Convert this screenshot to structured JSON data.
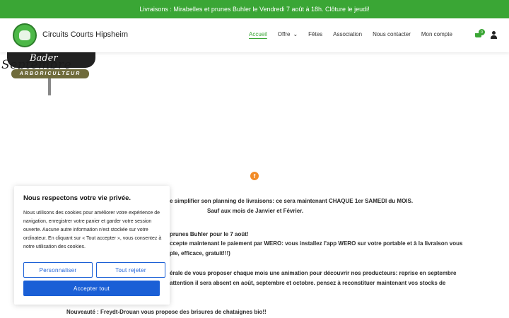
{
  "topbar": {
    "text": "Livraisons : Mirabelles et prunes Buhler le Vendredi 7 août à 18h. Clôture le jeudi!"
  },
  "header": {
    "site_title": "Circuits Courts Hipsheim",
    "nav": [
      {
        "label": "Accueil"
      },
      {
        "label": "Offre"
      },
      {
        "label": "Fêtes"
      },
      {
        "label": "Association"
      },
      {
        "label": "Nous contacter"
      },
      {
        "label": "Mon compte"
      }
    ],
    "cart_count": "0"
  },
  "sign": {
    "name": "Bader",
    "month": "Septembre",
    "subtitle": "ARBORICULTEUR"
  },
  "content": {
    "line1": "e simplifier son planning de livraisons: ce sera maintenant CHAQUE 1er SAMEDI du MOIS.",
    "line2": "Sauf aux mois de Janvier et Février.",
    "line3": " prunes Buhler pour le 7 août!",
    "line4": "ccepte maintenant le paiement par WERO: vous installez l'app WERO sur votre portable et à la livraison vous",
    "line5": "ple, efficace, gratuit!!!)",
    "line6": "érale de vous proposer chaque mois une animation pour découvrir nos producteurs: reprise en septembre",
    "line7": "attention il sera absent en août, septembre et octobre. pensez à reconstituer maintenant vos stocks de",
    "line8": "Nouveauté : Freydt-Drouan vous propose des brisures de chataignes bio!!"
  },
  "cookie": {
    "title": "Nous respectons votre vie privée.",
    "text": "Nous utilisons des cookies pour améliorer votre expérience de navigation, enregistrer votre panier et garder votre session ouverte. Aucune autre information n'est stockée sur votre ordinateur. En cliquant sur « Tout accepter », vous consentez à notre utilisation des cookies.",
    "customize_label": "Personnaliser",
    "reject_label": "Tout rejeter",
    "accept_label": "Accepter tout"
  }
}
